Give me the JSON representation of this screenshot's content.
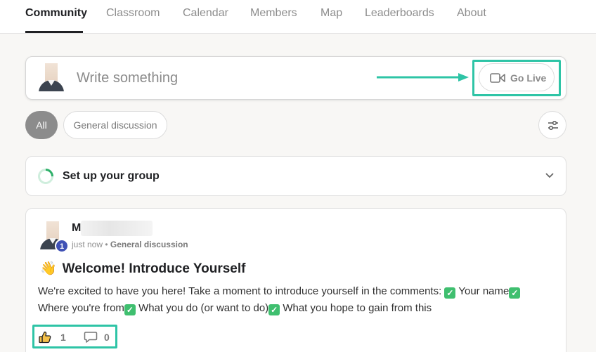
{
  "nav": {
    "tabs": [
      {
        "label": "Community",
        "active": true
      },
      {
        "label": "Classroom"
      },
      {
        "label": "Calendar"
      },
      {
        "label": "Members"
      },
      {
        "label": "Map"
      },
      {
        "label": "Leaderboards"
      },
      {
        "label": "About"
      }
    ]
  },
  "composer": {
    "placeholder": "Write something",
    "go_live_label": "Go Live",
    "go_live_icon": "video-camera-icon"
  },
  "filters": {
    "all_label": "All",
    "category_label": "General discussion",
    "settings_icon": "sliders-icon"
  },
  "setup": {
    "title": "Setup your group",
    "title_text": "Set up your group",
    "progress_icon": "progress-ring-icon",
    "expand_icon": "chevron-down-icon"
  },
  "post": {
    "author_initial": "M",
    "level_badge": "1",
    "time": "just now",
    "separator": " • ",
    "category": "General discussion",
    "title_emoji": "👋",
    "title": "Welcome! Introduce Yourself",
    "body_intro": "We're excited to have you here! Take a moment to introduce yourself in the comments:",
    "items": [
      "Your name",
      "Where you're from",
      "What you do (or want to do)",
      "What you hope to gain from this"
    ],
    "likes": "1",
    "comments": "0"
  },
  "colors": {
    "highlight": "#2ec4a6",
    "badge": "#3f51b5",
    "check": "#3fbf6f",
    "progress": "#2fb06a"
  }
}
